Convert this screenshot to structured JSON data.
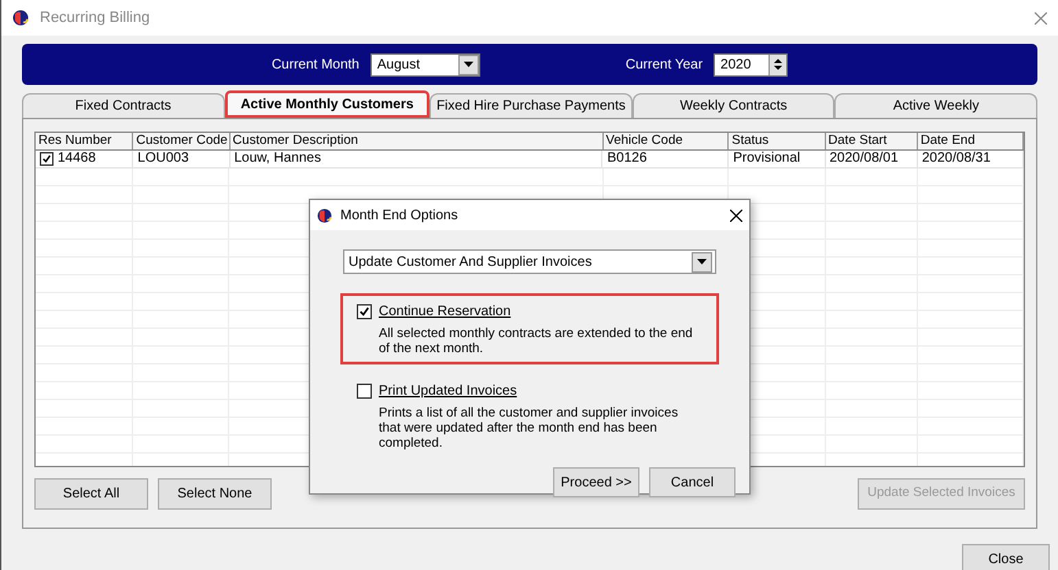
{
  "window": {
    "title": "Recurring Billing"
  },
  "header": {
    "month_label": "Current Month",
    "month": "August",
    "year_label": "Current Year",
    "year": "2020"
  },
  "tabs": [
    {
      "label": "Fixed Contracts",
      "selected": false
    },
    {
      "label": "Active Monthly Customers",
      "selected": true
    },
    {
      "label": "Fixed Hire Purchase Payments",
      "selected": false
    },
    {
      "label": "Weekly Contracts",
      "selected": false
    },
    {
      "label": "Active Weekly",
      "selected": false
    }
  ],
  "table": {
    "columns": [
      "Res Number",
      "Customer Code",
      "Customer Description",
      "Vehicle Code",
      "Status",
      "Date Start",
      "Date End"
    ],
    "rows": [
      {
        "checked": true,
        "cells": [
          "14468",
          "LOU003",
          "Louw, Hannes",
          "B0126",
          "Provisional",
          "2020/08/01",
          "2020/08/31"
        ]
      }
    ]
  },
  "buttons": [
    {
      "label": "Select All",
      "disabled": false
    },
    {
      "label": "Select None",
      "disabled": false
    }
  ],
  "update_button": {
    "label": "Update Selected Invoices",
    "disabled": true
  },
  "close_button": "Close",
  "dialog": {
    "title": "Month End Options",
    "action": "Update Customer And Supplier Invoices",
    "options": [
      {
        "label": "Continue Reservation",
        "checked": true,
        "highlighted": true,
        "description": "All selected monthly contracts are extended to the end of the next month."
      },
      {
        "label": "Print Updated Invoices",
        "checked": false,
        "highlighted": false,
        "description": "Prints a list of all the customer and supplier invoices that were updated after the month end has been completed."
      }
    ],
    "buttons": [
      "Proceed >>",
      "Cancel"
    ]
  }
}
